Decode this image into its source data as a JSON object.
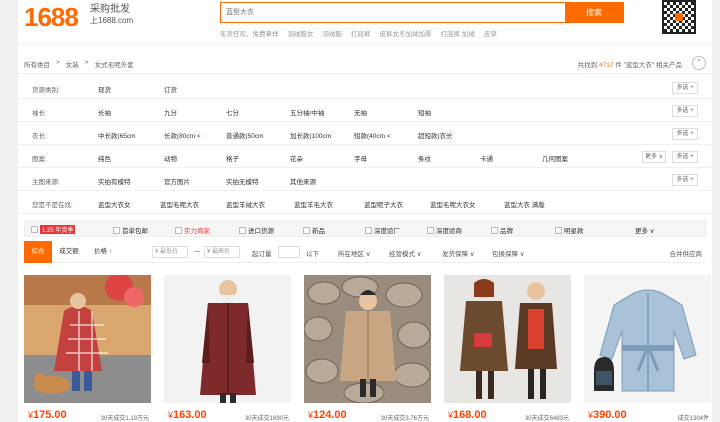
{
  "header": {
    "logo": "1688",
    "slogan_line1": "采购批发",
    "slogan_line2": "上1688.com",
    "search_placeholder": "蓝型大衣",
    "search_button": "搜索",
    "hot_keywords": [
      "年货狂欢，免费拿样",
      "羽绒服女",
      "羽绒服",
      "打底裤",
      "皮裤女冬加绒加厚",
      "打底裤 加绒",
      "皮草"
    ]
  },
  "breadcrumb": {
    "items": [
      "所有类目",
      ">",
      "女装",
      ">",
      "女式毛呢外套"
    ],
    "result_prefix": "共找到",
    "result_count": "4717",
    "result_suffix": "件 \"蓝型大衣\" 相关产品"
  },
  "filters": [
    {
      "label": "货源类别:",
      "options": [
        "现货",
        "订货"
      ],
      "more": "多选 +"
    },
    {
      "label": "袖长:",
      "options": [
        "长袖",
        "九分",
        "七分",
        "五分袖/中袖",
        "无袖",
        "短袖"
      ],
      "more": "多选 +"
    },
    {
      "label": "衣长:",
      "options": [
        "中长款(65cm",
        "长款(80cm <",
        "普通款(50cm",
        "加长款(100cm",
        "短款(40cm <",
        "超短款(衣长"
      ],
      "more": "多选 +"
    },
    {
      "label": "图案:",
      "options": [
        "纯色",
        "动物",
        "格子",
        "花朵",
        "字母",
        "条纹",
        "卡通",
        "几何图案"
      ],
      "more": "多选 +",
      "extra": "更多 ∨"
    },
    {
      "label": "主图来源:",
      "options": [
        "实拍有模特",
        "官方图片",
        "实拍无模特",
        "其他来源"
      ],
      "more": "多选 +"
    },
    {
      "label": "您是不是在找:",
      "options": [
        "蓝型大衣女",
        "蓝型毛呢大衣",
        "蓝型羊绒大衣",
        "蓝型羊毛大衣",
        "蓝型呢子大衣",
        "蓝型毛呢大衣女",
        "蓝型大衣 满版"
      ]
    }
  ],
  "services": {
    "promo_badge": "1.25 年货季",
    "items": [
      "首单包邮",
      "实力商家",
      "进口货源",
      "新品",
      "深度验厂",
      "深度验商",
      "品牌",
      "明星款"
    ],
    "more": "更多 ∨"
  },
  "sort": {
    "tabs": [
      "综合",
      "成交额",
      "价格 ↑"
    ],
    "min_price_placeholder": "¥ 最低价",
    "max_price_placeholder": "¥ 最高价",
    "dash": "—",
    "min_order": "起订量",
    "below": "以下",
    "region": "所在地区 ∨",
    "business_mode": "经营模式 ∨",
    "shipping": "发货保障 ∨",
    "package": "包换保障 ∨",
    "merge": "合并供应商"
  },
  "products": [
    {
      "price": "175.00",
      "sold": "30天成交1.19万元",
      "palette": [
        "#d9a76e",
        "#c3423f",
        "#e9d9c6",
        "#3a5a9a"
      ]
    },
    {
      "price": "163.00",
      "sold": "30天成交1690元",
      "palette": [
        "#f2f2f2",
        "#7e2a2a",
        "#5c1d1d",
        "#2c2c2c"
      ]
    },
    {
      "price": "124.00",
      "sold": "30天成交3.76万元",
      "palette": [
        "#9a8c7c",
        "#c9a683",
        "#5a4b3e",
        "#2a2a2a"
      ]
    },
    {
      "price": "168.00",
      "sold": "30天成交6483元",
      "palette": [
        "#e8e6e2",
        "#6b4a2e",
        "#d63a3a",
        "#3a2c22"
      ]
    },
    {
      "price": "390.00",
      "sold": "成交1304件",
      "palette": [
        "#f4f4f4",
        "#a9c2d8",
        "#7b9bb8",
        "#3e5468"
      ]
    }
  ],
  "colors": {
    "accent": "#ff6a00",
    "price": "#ff4400",
    "promo": "#e4393c"
  }
}
